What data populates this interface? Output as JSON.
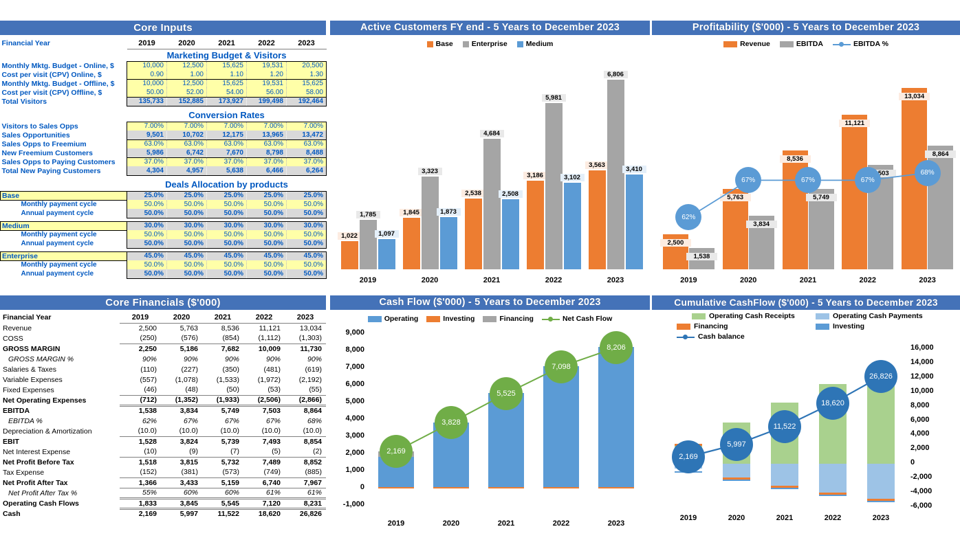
{
  "colors": {
    "header_blue": "#4472b8",
    "orange": "#ed7d31",
    "gray": "#a5a5a5",
    "blue": "#5b9bd5",
    "green": "#70ad47",
    "light_green": "#a9d18e",
    "light_blue": "#9dc3e6",
    "input_yellow": "#ffffa8",
    "output_gray": "#d9d9d9",
    "label_blue": "#0058c0"
  },
  "core_inputs": {
    "title": "Core Inputs",
    "year_label": "Financial Year",
    "years": [
      "2019",
      "2020",
      "2021",
      "2022",
      "2023"
    ],
    "section_marketing": "Marketing Budget & Visitors",
    "section_conversion": "Conversion Rates",
    "section_deals": "Deals Allocation by products",
    "marketing_rows": [
      {
        "label": "Monthly Mktg. Budget - Online, $",
        "type": "in",
        "values": [
          "10,000",
          "12,500",
          "15,625",
          "19,531",
          "20,500"
        ]
      },
      {
        "label": "Cost per visit (CPV) Online, $",
        "type": "in",
        "values": [
          "0.90",
          "1.00",
          "1.10",
          "1.20",
          "1.30"
        ]
      },
      {
        "label": "Monthly Mktg. Budget - Offline, $",
        "type": "in",
        "values": [
          "10,000",
          "12,500",
          "15,625",
          "19,531",
          "15,625"
        ]
      },
      {
        "label": "Cost per visit (CPV) Offline, $",
        "type": "in",
        "values": [
          "50.00",
          "52.00",
          "54.00",
          "56.00",
          "58.00"
        ]
      },
      {
        "label": "Total Visitors",
        "type": "out",
        "values": [
          "135,733",
          "152,885",
          "173,927",
          "199,498",
          "192,464"
        ]
      }
    ],
    "conversion_rows": [
      {
        "label": "Visitors to Sales Opps",
        "type": "in",
        "values": [
          "7.00%",
          "7.00%",
          "7.00%",
          "7.00%",
          "7.00%"
        ]
      },
      {
        "label": "Sales Opportunities",
        "type": "out",
        "values": [
          "9,501",
          "10,702",
          "12,175",
          "13,965",
          "13,472"
        ]
      },
      {
        "label": "Sales Opps to Freemium",
        "type": "in",
        "values": [
          "63.0%",
          "63.0%",
          "63.0%",
          "63.0%",
          "63.0%"
        ]
      },
      {
        "label": "New Freemium Customers",
        "type": "out",
        "values": [
          "5,986",
          "6,742",
          "7,670",
          "8,798",
          "8,488"
        ]
      },
      {
        "label": "Sales Opps to Paying Customers",
        "type": "in",
        "values": [
          "37.0%",
          "37.0%",
          "37.0%",
          "37.0%",
          "37.0%"
        ]
      },
      {
        "label": "Total New Paying Customers",
        "type": "out",
        "values": [
          "4,304",
          "4,957",
          "5,638",
          "6,466",
          "6,264"
        ]
      }
    ],
    "products": [
      {
        "name": "Base",
        "alloc": {
          "type": "out",
          "values": [
            "25.0%",
            "25.0%",
            "25.0%",
            "25.0%",
            "25.0%"
          ]
        },
        "monthly_label": "Monthly payment cycle",
        "monthly": {
          "type": "in",
          "values": [
            "50.0%",
            "50.0%",
            "50.0%",
            "50.0%",
            "50.0%"
          ]
        },
        "annual_label": "Annual payment cycle",
        "annual": {
          "type": "out",
          "values": [
            "50.0%",
            "50.0%",
            "50.0%",
            "50.0%",
            "50.0%"
          ]
        }
      },
      {
        "name": "Medium",
        "alloc": {
          "type": "out",
          "values": [
            "30.0%",
            "30.0%",
            "30.0%",
            "30.0%",
            "30.0%"
          ]
        },
        "monthly_label": "Monthly payment cycle",
        "monthly": {
          "type": "in",
          "values": [
            "50.0%",
            "50.0%",
            "50.0%",
            "50.0%",
            "50.0%"
          ]
        },
        "annual_label": "Annual payment cycle",
        "annual": {
          "type": "out",
          "values": [
            "50.0%",
            "50.0%",
            "50.0%",
            "50.0%",
            "50.0%"
          ]
        }
      },
      {
        "name": "Enterprise",
        "alloc": {
          "type": "out",
          "values": [
            "45.0%",
            "45.0%",
            "45.0%",
            "45.0%",
            "45.0%"
          ]
        },
        "monthly_label": "Monthly payment cycle",
        "monthly": {
          "type": "in",
          "values": [
            "50.0%",
            "50.0%",
            "50.0%",
            "50.0%",
            "50.0%"
          ]
        },
        "annual_label": "Annual payment cycle",
        "annual": {
          "type": "out",
          "values": [
            "50.0%",
            "50.0%",
            "50.0%",
            "50.0%",
            "50.0%"
          ]
        }
      }
    ]
  },
  "core_financials": {
    "title": "Core Financials ($'000)",
    "year_label": "Financial Year",
    "years": [
      "2019",
      "2020",
      "2021",
      "2022",
      "2023"
    ],
    "rows": [
      {
        "label": "Revenue",
        "values": [
          "2,500",
          "5,763",
          "8,536",
          "11,121",
          "13,034"
        ],
        "style": ""
      },
      {
        "label": "COSS",
        "values": [
          "(250)",
          "(576)",
          "(854)",
          "(1,112)",
          "(1,303)"
        ],
        "style": ""
      },
      {
        "label": "GROSS MARGIN",
        "values": [
          "2,250",
          "5,186",
          "7,682",
          "10,009",
          "11,730"
        ],
        "style": "bold topline"
      },
      {
        "label": "GROSS MARGIN %",
        "values": [
          "90%",
          "90%",
          "90%",
          "90%",
          "90%"
        ],
        "style": "ital indent"
      },
      {
        "label": "Salaries & Taxes",
        "values": [
          "(110)",
          "(227)",
          "(350)",
          "(481)",
          "(619)"
        ],
        "style": ""
      },
      {
        "label": "Variable Expenses",
        "values": [
          "(557)",
          "(1,078)",
          "(1,533)",
          "(1,972)",
          "(2,192)"
        ],
        "style": ""
      },
      {
        "label": "Fixed Expenses",
        "values": [
          "(46)",
          "(48)",
          "(50)",
          "(53)",
          "(55)"
        ],
        "style": ""
      },
      {
        "label": "Net Operating Expenses",
        "values": [
          "(712)",
          "(1,352)",
          "(1,933)",
          "(2,506)",
          "(2,866)"
        ],
        "style": "bold topline"
      },
      {
        "label": "EBITDA",
        "values": [
          "1,538",
          "3,834",
          "5,749",
          "7,503",
          "8,864"
        ],
        "style": "bold dbl"
      },
      {
        "label": "EBITDA %",
        "values": [
          "62%",
          "67%",
          "67%",
          "67%",
          "68%"
        ],
        "style": "ital indent"
      },
      {
        "label": "Depreciation & Amortization",
        "values": [
          "(10.0)",
          "(10.0)",
          "(10.0)",
          "(10.0)",
          "(10.0)"
        ],
        "style": ""
      },
      {
        "label": "EBIT",
        "values": [
          "1,528",
          "3,824",
          "5,739",
          "7,493",
          "8,854"
        ],
        "style": "bold topline"
      },
      {
        "label": "Net Interest Expense",
        "values": [
          "(10)",
          "(9)",
          "(7)",
          "(5)",
          "(2)"
        ],
        "style": ""
      },
      {
        "label": "Net Profit Before Tax",
        "values": [
          "1,518",
          "3,815",
          "5,732",
          "7,489",
          "8,852"
        ],
        "style": "bold topline"
      },
      {
        "label": "Tax Expense",
        "values": [
          "(152)",
          "(381)",
          "(573)",
          "(749)",
          "(885)"
        ],
        "style": ""
      },
      {
        "label": "Net Profit After Tax",
        "values": [
          "1,366",
          "3,433",
          "5,159",
          "6,740",
          "7,967"
        ],
        "style": "bold topline"
      },
      {
        "label": "Net Profit After Tax %",
        "values": [
          "55%",
          "60%",
          "60%",
          "61%",
          "61%"
        ],
        "style": "ital indent topline"
      },
      {
        "label": "Operating Cash Flows",
        "values": [
          "1,833",
          "3,845",
          "5,545",
          "7,120",
          "8,231"
        ],
        "style": "bold dbl"
      },
      {
        "label": "Cash",
        "values": [
          "2,169",
          "5,997",
          "11,522",
          "18,620",
          "26,826"
        ],
        "style": "bold dbl"
      }
    ]
  },
  "chart_data": [
    {
      "id": "active_customers",
      "type": "bar",
      "title": "Active Customers FY end - 5 Years to December 2023",
      "categories": [
        "2019",
        "2020",
        "2021",
        "2022",
        "2023"
      ],
      "legend": [
        "Base",
        "Enterprise",
        "Medium"
      ],
      "legend_position": "top",
      "grid": false,
      "xlabel": "",
      "ylabel": "",
      "ylim": [
        0,
        7200
      ],
      "series": [
        {
          "name": "Base",
          "color": "#ed7d31",
          "values": [
            1022,
            1845,
            2538,
            3186,
            3563
          ],
          "labels": [
            "1,022",
            "1,845",
            "2,538",
            "3,186",
            "3,563"
          ]
        },
        {
          "name": "Enterprise",
          "color": "#a5a5a5",
          "values": [
            1785,
            3323,
            4684,
            5981,
            6806
          ],
          "labels": [
            "1,785",
            "3,323",
            "4,684",
            "5,981",
            "6,806"
          ]
        },
        {
          "name": "Medium",
          "color": "#5b9bd5",
          "values": [
            1097,
            1873,
            2508,
            3102,
            3410
          ],
          "labels": [
            "1,097",
            "1,873",
            "2,508",
            "3,102",
            "3,410"
          ]
        }
      ]
    },
    {
      "id": "profitability",
      "type": "bar",
      "title": "Profitability ($'000) - 5 Years to December 2023",
      "categories": [
        "2019",
        "2020",
        "2021",
        "2022",
        "2023"
      ],
      "legend": [
        "Revenue",
        "EBITDA",
        "EBITDA %"
      ],
      "legend_position": "top",
      "grid": false,
      "xlabel": "",
      "ylabel": "",
      "ylim": [
        0,
        14500
      ],
      "series": [
        {
          "name": "Revenue",
          "color": "#ed7d31",
          "values": [
            2500,
            5763,
            8536,
            11121,
            13034
          ],
          "labels": [
            "2,500",
            "5,763",
            "8,536",
            "11,121",
            "13,034"
          ]
        },
        {
          "name": "EBITDA",
          "color": "#a5a5a5",
          "values": [
            1538,
            3834,
            5749,
            7503,
            8864
          ],
          "labels": [
            "1,538",
            "3,834",
            "5,749",
            "7,503",
            "8,864"
          ]
        }
      ],
      "line_series": {
        "name": "EBITDA %",
        "color": "#5b9bd5",
        "values": [
          62,
          67,
          67,
          67,
          68
        ],
        "labels": [
          "62%",
          "67%",
          "67%",
          "67%",
          "68%"
        ]
      }
    },
    {
      "id": "cash_flow",
      "type": "bar",
      "title": "Cash Flow ($'000) - 5 Years to December 2023",
      "categories": [
        "2019",
        "2020",
        "2021",
        "2022",
        "2023"
      ],
      "legend": [
        "Operating",
        "Investing",
        "Financing",
        "Net Cash Flow"
      ],
      "legend_position": "top",
      "grid": false,
      "xlabel": "",
      "ylabel": "",
      "ylim": [
        -1000,
        9000
      ],
      "yticks": [
        "9,000",
        "8,000",
        "7,000",
        "6,000",
        "5,000",
        "4,000",
        "3,000",
        "2,000",
        "1,000",
        "0",
        "-1,000"
      ],
      "series": [
        {
          "name": "Operating",
          "color": "#5b9bd5",
          "values": [
            1833,
            3845,
            5545,
            7120,
            8231
          ]
        },
        {
          "name": "Investing",
          "color": "#ed7d31",
          "values": [
            -10,
            -10,
            -10,
            -10,
            -10
          ]
        },
        {
          "name": "Financing",
          "color": "#a5a5a5",
          "values": [
            346,
            0,
            0,
            0,
            0
          ]
        }
      ],
      "line_series": {
        "name": "Net Cash Flow",
        "color": "#70ad47",
        "values": [
          2169,
          3828,
          5525,
          7098,
          8206
        ],
        "labels": [
          "2,169",
          "3,828",
          "5,525",
          "7,098",
          "8,206"
        ]
      }
    },
    {
      "id": "cumulative_cashflow",
      "type": "bar",
      "title": "Cumulative CashFlow ($'000) - 5 Years to December 2023",
      "categories": [
        "2019",
        "2020",
        "2021",
        "2022",
        "2023"
      ],
      "legend": [
        "Operating Cash Receipts",
        "Operating Cash Payments",
        "Financing",
        "Investing",
        "Cash balance"
      ],
      "legend_position": "top",
      "grid": false,
      "xlabel": "",
      "ylabel": "",
      "ylim": [
        -6000,
        16000
      ],
      "yticks": [
        "16,000",
        "14,000",
        "12,000",
        "10,000",
        "8,000",
        "6,000",
        "4,000",
        "2,000",
        "0",
        "-2,000",
        "-4,000",
        "-6,000"
      ],
      "series": [
        {
          "name": "Operating Cash Receipts",
          "color": "#a9d18e",
          "values": [
            2500,
            5763,
            8536,
            11121,
            13034
          ]
        },
        {
          "name": "Operating Cash Payments",
          "color": "#9dc3e6",
          "values": [
            -667,
            -1918,
            -2991,
            -4001,
            -4803
          ]
        },
        {
          "name": "Financing",
          "color": "#ed7d31",
          "values": [
            336,
            0,
            -26,
            -30,
            -35
          ]
        },
        {
          "name": "Investing",
          "color": "#5b9bd5",
          "values": [
            -10,
            -10,
            -10,
            -10,
            -10
          ]
        }
      ],
      "line_series": {
        "name": "Cash balance",
        "color": "#2e75b6",
        "values": [
          2169,
          5997,
          11522,
          18620,
          26826
        ],
        "labels": [
          "2,169",
          "5,997",
          "11,522",
          "18,620",
          "26,826"
        ]
      }
    }
  ]
}
